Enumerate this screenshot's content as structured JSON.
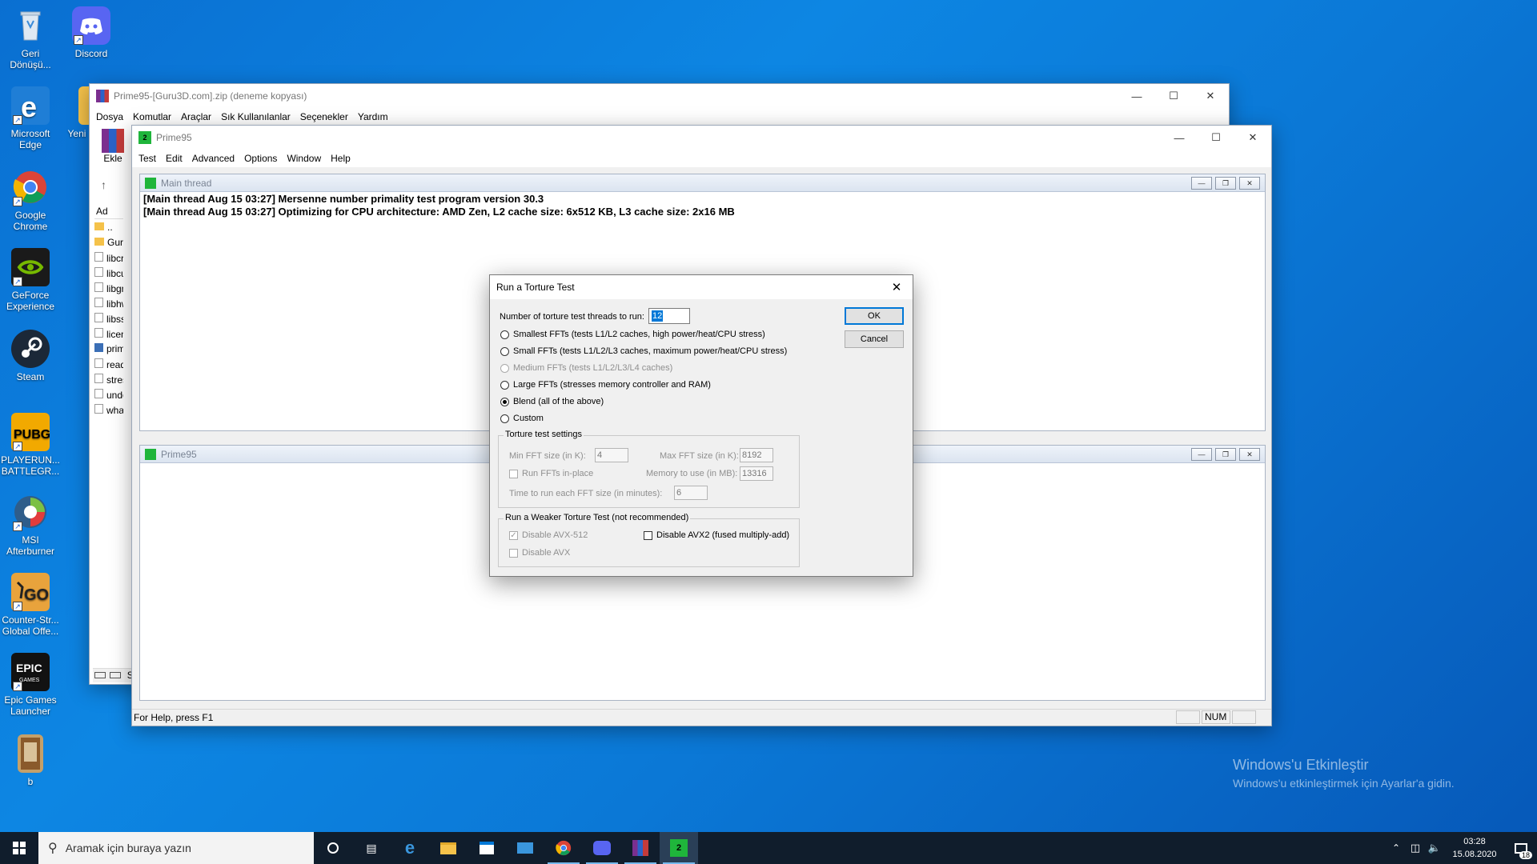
{
  "desktop": {
    "icons": [
      {
        "label": "Geri Dönüşü...",
        "icon": "recycle-bin-icon"
      },
      {
        "label": "Discord",
        "icon": "discord-icon"
      },
      {
        "label": "Microsoft Edge",
        "icon": "edge-icon"
      },
      {
        "label": "Yeni",
        "icon": "folder-icon"
      },
      {
        "label": "Google Chrome",
        "icon": "chrome-icon"
      },
      {
        "label": "GeForce Experience",
        "icon": "geforce-icon"
      },
      {
        "label": "Steam",
        "icon": "steam-icon"
      },
      {
        "label": "PLAYERUN... BATTLEGR...",
        "icon": "pubg-icon"
      },
      {
        "label": "MSI Afterburner",
        "icon": "msi-afterburner-icon"
      },
      {
        "label": "Counter-Str... Global Offe...",
        "icon": "csgo-icon"
      },
      {
        "label": "Epic Games Launcher",
        "icon": "epic-games-icon"
      },
      {
        "label": "b",
        "icon": "book-icon"
      }
    ],
    "watermark": {
      "title": "Windows'u Etkinleştir",
      "subtitle": "Windows'u etkinleştirmek için Ayarlar'a gidin."
    }
  },
  "winrar": {
    "title": "Prime95-[Guru3D.com].zip (deneme kopyası)",
    "menu": [
      "Dosya",
      "Komutlar",
      "Araçlar",
      "Sık Kullanılanlar",
      "Seçenekler",
      "Yardım"
    ],
    "toolbar_label": "Ekle",
    "column_header": "Ad",
    "files": [
      "..",
      "Guru",
      "libcry",
      "libcu",
      "libgm",
      "libhw",
      "libssl",
      "licens",
      "prime",
      "readr",
      "stress",
      "undo",
      "whats"
    ],
    "status_letter": "S"
  },
  "prime95": {
    "title": "Prime95",
    "menu": [
      "Test",
      "Edit",
      "Advanced",
      "Options",
      "Window",
      "Help"
    ],
    "main_thread": {
      "title": "Main thread",
      "lines": [
        "[Main thread Aug 15 03:27] Mersenne number primality test program version 30.3",
        "[Main thread Aug 15 03:27] Optimizing for CPU architecture: AMD Zen, L2 cache size: 6x512 KB, L3 cache size: 2x16 MB"
      ]
    },
    "second_child_title": "Prime95",
    "status": "For Help, press F1",
    "num_indicator": "NUM"
  },
  "dialog": {
    "title": "Run a Torture Test",
    "threads_label": "Number of torture test threads to run:",
    "threads_value": "12",
    "options": [
      {
        "label": "Smallest FFTs (tests L1/L2 caches, high power/heat/CPU stress)",
        "checked": false,
        "disabled": false
      },
      {
        "label": "Small FFTs (tests L1/L2/L3 caches, maximum power/heat/CPU stress)",
        "checked": false,
        "disabled": false
      },
      {
        "label": "Medium FFTs (tests L1/L2/L3/L4 caches)",
        "checked": false,
        "disabled": true
      },
      {
        "label": "Large FFTs (stresses memory controller and RAM)",
        "checked": false,
        "disabled": false
      },
      {
        "label": "Blend (all of the above)",
        "checked": true,
        "disabled": false
      },
      {
        "label": "Custom",
        "checked": false,
        "disabled": false
      }
    ],
    "settings": {
      "group_title": "Torture test settings",
      "min_fft_label": "Min FFT size (in K):",
      "min_fft_value": "4",
      "max_fft_label": "Max FFT size (in K):",
      "max_fft_value": "8192",
      "run_inplace_label": "Run FFTs in-place",
      "memory_label": "Memory to use (in MB):",
      "memory_value": "13316",
      "time_label": "Time to run each FFT size (in minutes):",
      "time_value": "6"
    },
    "weaker": {
      "group_title": "Run a Weaker Torture Test (not recommended)",
      "disable_avx512": "Disable AVX-512",
      "disable_avx2": "Disable AVX2 (fused multiply-add)",
      "disable_avx": "Disable AVX"
    },
    "ok_label": "OK",
    "cancel_label": "Cancel"
  },
  "taskbar": {
    "search_placeholder": "Aramak için buraya yazın",
    "time": "03:28",
    "date": "15.08.2020",
    "notification_count": "18"
  }
}
